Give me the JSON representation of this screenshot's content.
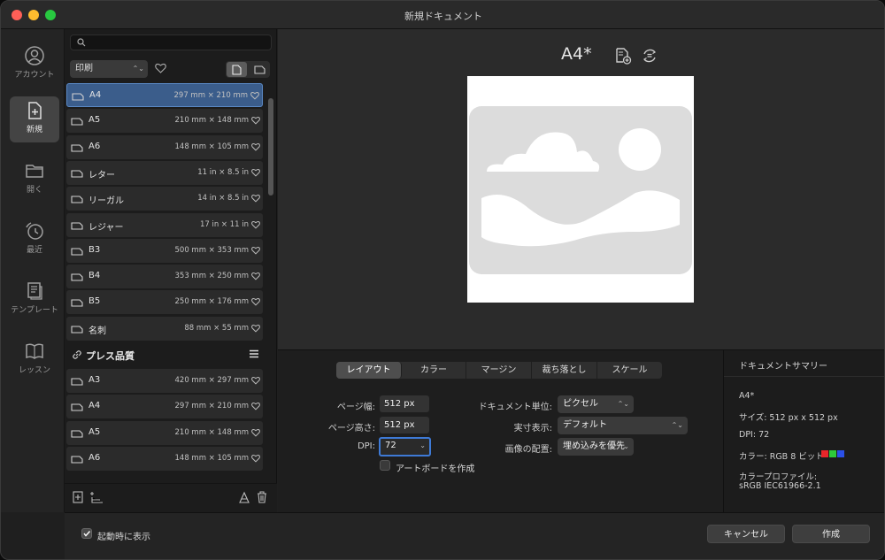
{
  "window": {
    "title": "新規ドキュメント"
  },
  "nav": {
    "items": [
      {
        "label": "アカウント",
        "icon": "account-icon"
      },
      {
        "label": "新規",
        "icon": "new-document-icon",
        "active": true
      },
      {
        "label": "開く",
        "icon": "folder-icon"
      },
      {
        "label": "最近",
        "icon": "recent-clock-icon"
      },
      {
        "label": "テンプレート",
        "icon": "template-icon"
      },
      {
        "label": "レッスン",
        "icon": "book-icon"
      }
    ]
  },
  "presets": {
    "search_placeholder": "",
    "category": "印刷",
    "rows": [
      {
        "name": "A4",
        "dims": "297 mm × 210 mm",
        "selected": true
      },
      {
        "name": "A5",
        "dims": "210 mm × 148 mm"
      },
      {
        "name": "A6",
        "dims": "148 mm × 105 mm"
      },
      {
        "name": "レター",
        "dims": "11 in × 8.5 in"
      },
      {
        "name": "リーガル",
        "dims": "14 in × 8.5 in"
      },
      {
        "name": "レジャー",
        "dims": "17 in × 11 in"
      },
      {
        "name": "B3",
        "dims": "500 mm × 353 mm"
      },
      {
        "name": "B4",
        "dims": "353 mm × 250 mm"
      },
      {
        "name": "B5",
        "dims": "250 mm × 176 mm"
      },
      {
        "name": "名刺",
        "dims": "88 mm × 55 mm"
      }
    ],
    "section2": "プレス品質",
    "rows2": [
      {
        "name": "A3",
        "dims": "420 mm × 297 mm"
      },
      {
        "name": "A4",
        "dims": "297 mm × 210 mm"
      },
      {
        "name": "A5",
        "dims": "210 mm × 148 mm"
      },
      {
        "name": "A6",
        "dims": "148 mm × 105 mm"
      }
    ]
  },
  "preview": {
    "title": "A4*"
  },
  "settings": {
    "tabs": [
      "レイアウト",
      "カラー",
      "マージン",
      "裁ち落とし",
      "スケール"
    ],
    "active_tab": 0,
    "page_width_label": "ページ幅:",
    "page_width_value": "512 px",
    "page_height_label": "ページ高さ:",
    "page_height_value": "512 px",
    "dpi_label": "DPI:",
    "dpi_value": "72",
    "artboard_label": "アートボードを作成",
    "unit_label": "ドキュメント単位:",
    "unit_value": "ピクセル",
    "display_label": "実寸表示:",
    "display_value": "デフォルト",
    "placement_label": "画像の配置:",
    "placement_value": "埋め込みを優先"
  },
  "summary": {
    "header": "ドキュメントサマリー",
    "name": "A4*",
    "size": "サイズ: 512 px x 512 px",
    "dpi": "DPI:  72",
    "color": "カラー: RGB 8 ビット",
    "profile_label": "カラープロファイル:",
    "profile_value": "sRGB IEC61966-2.1",
    "swatches": [
      "#e8262a",
      "#2ec93a",
      "#2b50e8"
    ]
  },
  "bottom": {
    "show_on_startup": "起動時に表示",
    "cancel": "キャンセル",
    "create": "作成"
  }
}
